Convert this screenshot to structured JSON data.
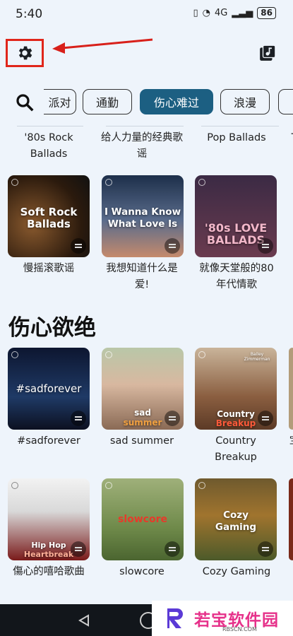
{
  "status": {
    "time": "5:40",
    "battery": "86",
    "net": "4G"
  },
  "search_label": "搜索",
  "chips": [
    "派对",
    "通勤",
    "伤心难过",
    "浪漫",
    "T"
  ],
  "top_row": [
    {
      "caption": "'80s Rock Ballads"
    },
    {
      "caption": "给人力量的经典歌谣"
    },
    {
      "caption": "Pop Ballads"
    },
    {
      "caption": "T"
    }
  ],
  "row1": [
    {
      "cover_text": "Soft Rock Ballads",
      "caption": "慢摇滚歌谣"
    },
    {
      "cover_text": "I Wanna Know What Love Is",
      "caption": "我想知道什么是爱!"
    },
    {
      "cover_text": "'80s LOVE BALLADS",
      "caption": "就像天堂般的80年代情歌"
    }
  ],
  "section_title": "伤心欲绝",
  "row2": [
    {
      "cover_text": "#sadforever",
      "caption": "#sadforever"
    },
    {
      "cover_text": "sad",
      "cover_text2": "summer",
      "caption": "sad summer"
    },
    {
      "cover_text": "Country",
      "cover_text2": "Breakup",
      "caption": "Country Breakup",
      "cover_small": "Bailey Zimmerman"
    },
    {
      "caption": "宝"
    }
  ],
  "row3": [
    {
      "cover_text": "Hip Hop",
      "cover_text2": "Heartbreak",
      "caption": "傷心的嘻哈歌曲"
    },
    {
      "cover_text": "slowcore",
      "caption": "slowcore"
    },
    {
      "cover_text": "Cozy Gaming",
      "caption": "Cozy Gaming"
    }
  ],
  "watermark": {
    "name": "若宝软件园",
    "url": "RBSCN.COM"
  }
}
